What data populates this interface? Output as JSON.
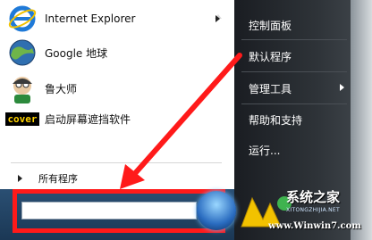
{
  "start_menu": {
    "pinned": [
      {
        "label": "Internet Explorer",
        "icon": "internet-explorer-icon",
        "has_submenu": true
      },
      {
        "label": "Google 地球",
        "icon": "google-earth-icon",
        "has_submenu": false
      },
      {
        "label": "鲁大师",
        "icon": "ludashi-icon",
        "has_submenu": false
      },
      {
        "label": "启动屏幕遮挡软件",
        "icon": "cover-app-icon",
        "icon_text": "cover",
        "has_submenu": false
      }
    ],
    "all_programs": "所有程序",
    "search": {
      "value": "",
      "placeholder": ""
    }
  },
  "right_pane": {
    "items": [
      {
        "label": "控制面板",
        "has_submenu": false
      },
      {
        "label": "默认程序",
        "has_submenu": false
      },
      {
        "label": "管理工具",
        "has_submenu": true
      },
      {
        "label": "帮助和支持",
        "has_submenu": false
      },
      {
        "label": "运行...",
        "has_submenu": false
      }
    ]
  },
  "watermark": {
    "title": "系统之家",
    "subtitle": "XITONGZHIJIA.NET",
    "url": "www.Winwin7.com"
  },
  "colors": {
    "highlight": "#ff1a1a",
    "right_pane": "#2e3338",
    "left_pane": "#ffffff"
  }
}
